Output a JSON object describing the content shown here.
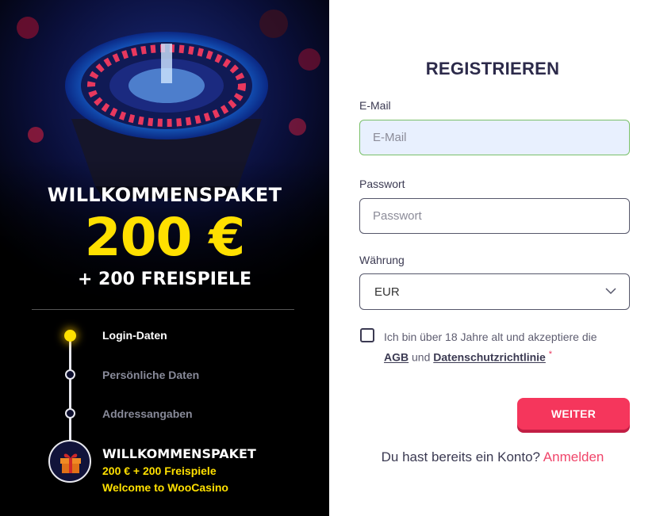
{
  "promo": {
    "title": "WILLKOMMENSPAKET",
    "amount": "200 €",
    "spins": "+ 200 FREISPIELE"
  },
  "steps": [
    {
      "label": "Login-Daten",
      "active": true
    },
    {
      "label": "Persönliche Daten",
      "active": false
    },
    {
      "label": "Addressangaben",
      "active": false
    }
  ],
  "bonus": {
    "icon": "gift-icon",
    "title": "WILLKOMMENSPAKET",
    "line1": "200 € + 200 Freispiele",
    "line2": "Welcome to WooCasino"
  },
  "form": {
    "title": "REGISTRIEREN",
    "email": {
      "label": "E-Mail",
      "placeholder": "E-Mail",
      "value": ""
    },
    "password": {
      "label": "Passwort",
      "placeholder": "Passwort",
      "value": ""
    },
    "currency": {
      "label": "Währung",
      "selected": "EUR"
    },
    "terms": {
      "checked": false,
      "text_before": "Ich bin über 18 Jahre alt und akzeptiere die",
      "link_agb": "AGB",
      "text_and": "und",
      "link_privacy": "Datenschutzrichtlinie",
      "required_mark": "*"
    },
    "submit_label": "WEITER",
    "login_prompt": "Du hast bereits ein Konto?",
    "login_link": "Anmelden"
  },
  "colors": {
    "accent": "#f5365c",
    "promo_yellow": "#ffe000",
    "title_text": "#2c2a4a",
    "left_background": "#000000"
  }
}
